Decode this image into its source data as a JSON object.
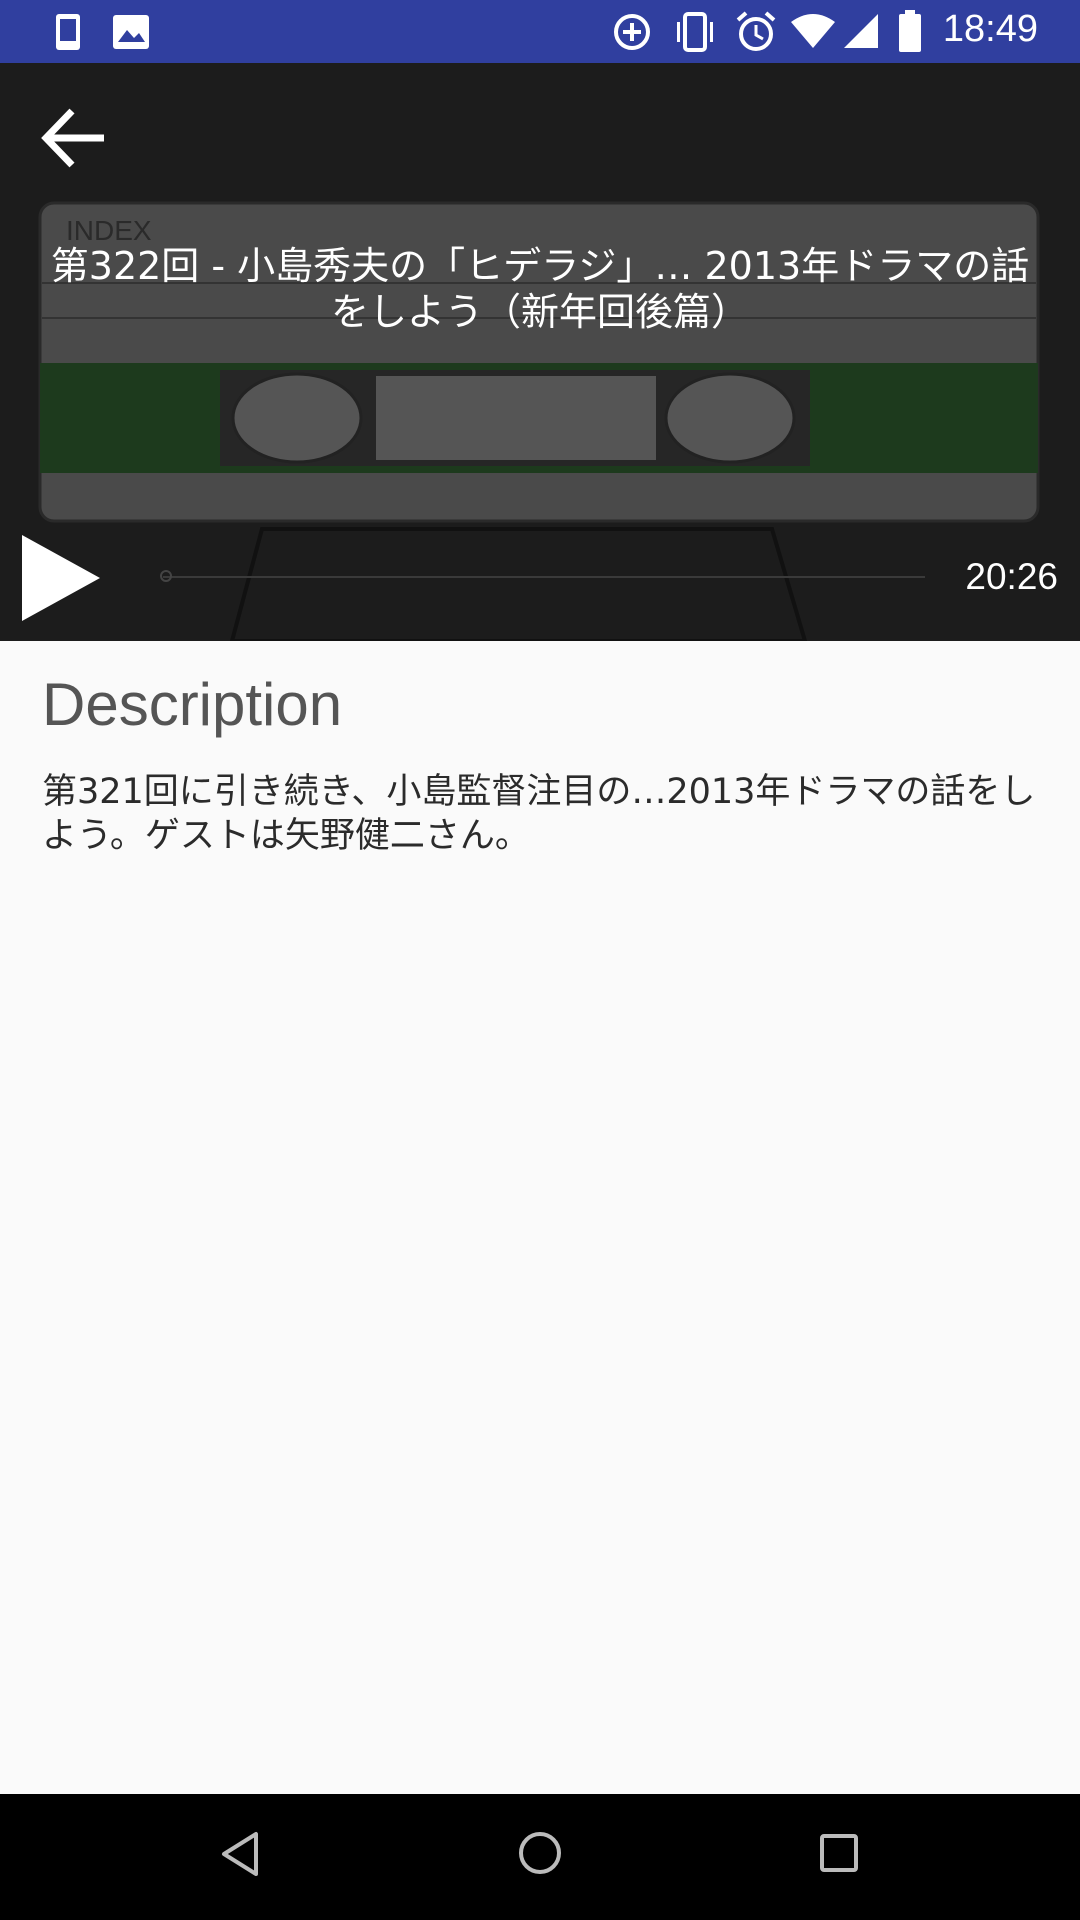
{
  "status_bar": {
    "time": "18:49",
    "left_icons": [
      "phone-icon",
      "image-icon"
    ],
    "right_icons": [
      "data-saver-icon",
      "vibrate-icon",
      "alarm-icon",
      "wifi-icon",
      "signal-icon",
      "battery-icon"
    ],
    "color": "#303f9f"
  },
  "player": {
    "cover_label": "INDEX",
    "episode_title": "第322回 - 小島秀夫の「ヒデラジ」… 2013年ドラマの話をしよう（新年回後篇）",
    "duration": "20:26",
    "progress": 0,
    "background": "#1c1c1c"
  },
  "content": {
    "heading": "Description",
    "body": "第321回に引き続き、小島監督注目の…2013年ドラマの話をしよう。ゲストは矢野健二さん。"
  },
  "nav_bar": {
    "icons": [
      "back-triangle-icon",
      "home-circle-icon",
      "recents-square-icon"
    ]
  }
}
